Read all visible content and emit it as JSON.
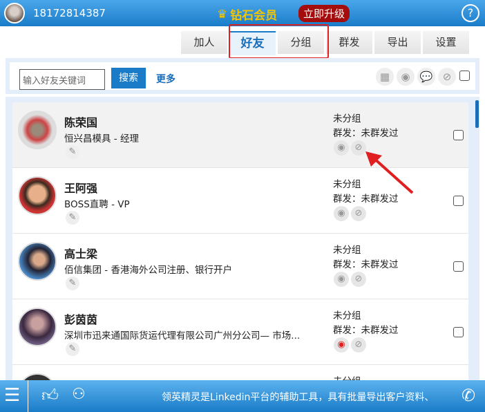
{
  "header": {
    "phone": "18172814387",
    "vip_label": "钻石会员",
    "upgrade_label": "立即升级",
    "help": "?"
  },
  "tabs": [
    "加人",
    "好友",
    "分组",
    "群发",
    "导出",
    "设置"
  ],
  "toolbar": {
    "search_placeholder": "输入好友关键词",
    "search_label": "搜索",
    "more_label": "更多"
  },
  "contacts": [
    {
      "name": "陈荣国",
      "title": "恒兴昌模具 - 经理",
      "group": "未分组",
      "mass": "群发：未群发过"
    },
    {
      "name": "王阿强",
      "title": "BOSS直聘 - VP",
      "group": "未分组",
      "mass": "群发：未群发过"
    },
    {
      "name": "高士梁",
      "title": "佰信集团 - 香港海外公司注册、银行开户",
      "group": "未分组",
      "mass": "群发：未群发过"
    },
    {
      "name": "彭茵茵",
      "title": "深圳市迅来通国际货运代理有限公司广州分公司— 市场...",
      "group": "未分组",
      "mass": "群发：未群发过"
    },
    {
      "name": "",
      "title": "",
      "group": "未分组",
      "mass": ""
    }
  ],
  "footer": {
    "marquee": "领英精灵是Linkedin平台的辅助工具，具有批量导出客户资料、"
  },
  "colors": {
    "brand": "#1a7cc8",
    "highlight": "#e02020"
  }
}
